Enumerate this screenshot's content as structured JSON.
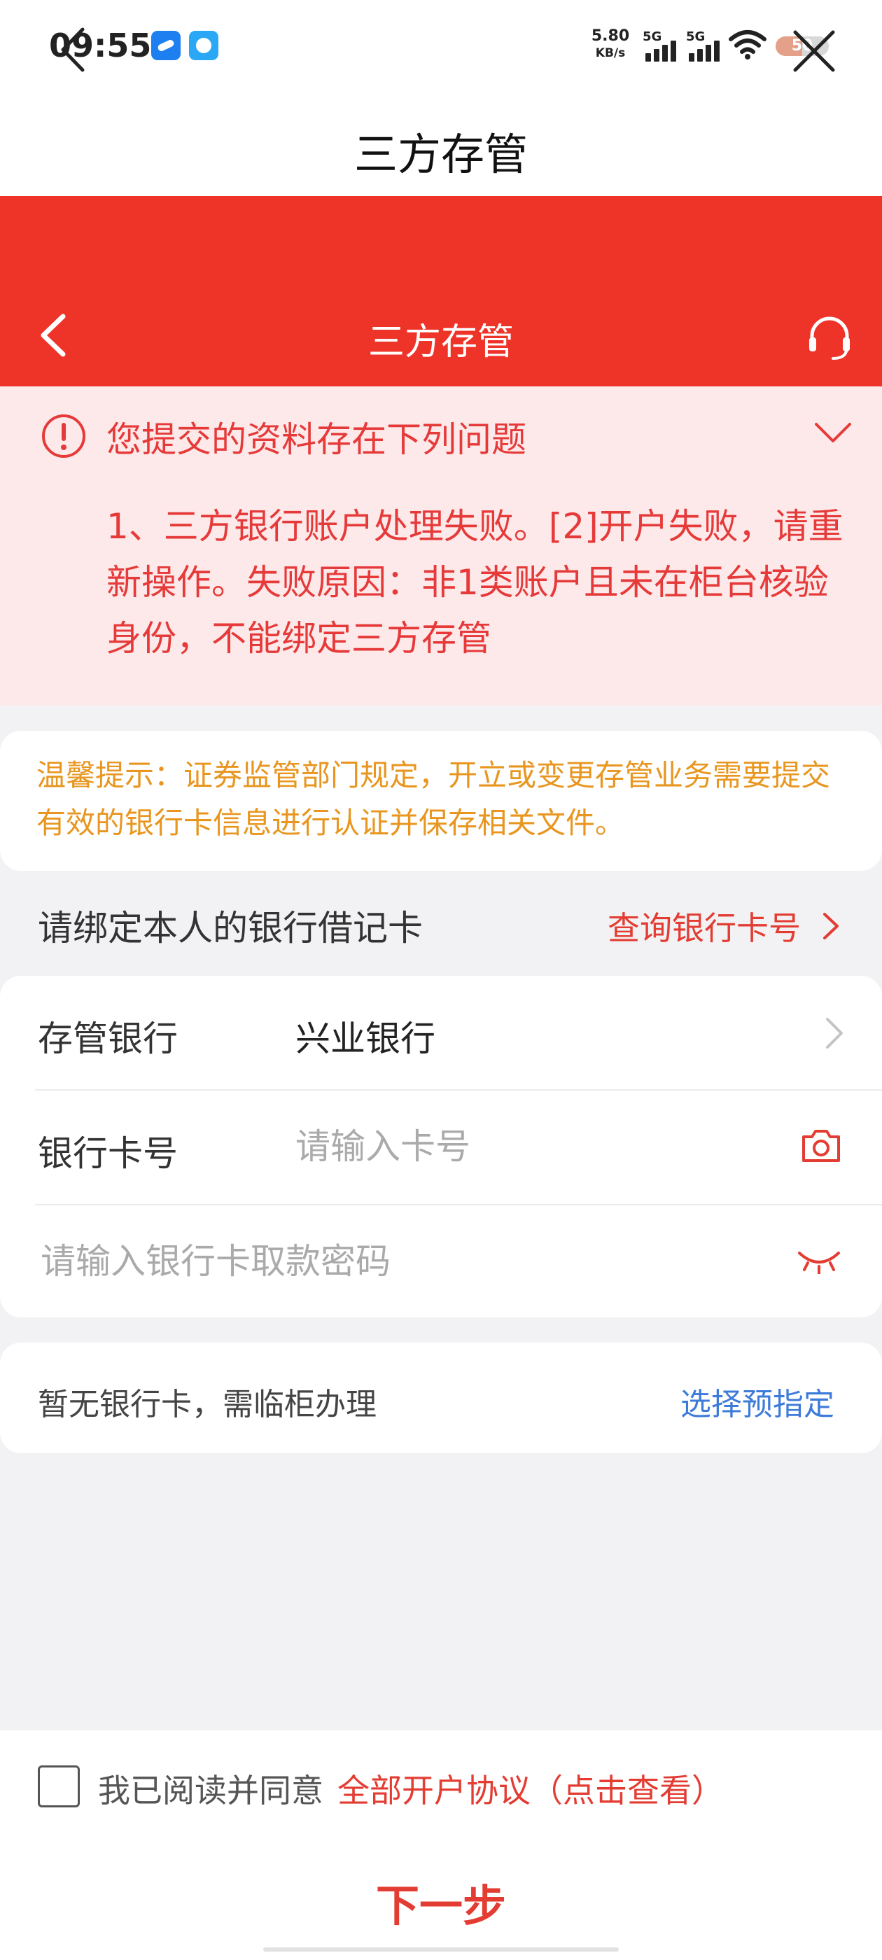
{
  "status_bar": {
    "time": "09:55",
    "net_speed": "5.80",
    "net_speed_unit": "KB/s",
    "signal_1_label": "5G",
    "signal_2_label": "5G",
    "battery_level": "50",
    "battery_percent": 50,
    "icons": [
      "app-icon-blue",
      "app-icon-bird",
      "wifi-icon",
      "battery-icon"
    ]
  },
  "navbar": {
    "title": "三方存管",
    "back_icon": "chevron-left-icon",
    "close_icon": "close-icon"
  },
  "app_header": {
    "title": "三方存管",
    "background_color": "#ee3329",
    "back_icon": "chevron-left-icon",
    "service_icon": "headset-icon"
  },
  "error_panel": {
    "title": "您提交的资料存在下列问题",
    "message": "1、三方银行账户处理失败。[2]开户失败，请重新操作。失败原因：非1类账户且未在柜台核验身份，不能绑定三方存管",
    "color": "#e63a3a"
  },
  "notice": {
    "text": "温馨提示：证券监管部门规定，开立或变更存管业务需要提交有效的银行卡信息进行认证并保存相关文件。",
    "color": "#e8961f"
  },
  "bind_section": {
    "label": "请绑定本人的银行借记卡",
    "query_link": "查询银行卡号"
  },
  "form": {
    "bank_label": "存管银行",
    "bank_value": "兴业银行",
    "card_label": "银行卡号",
    "card_value": "",
    "card_placeholder": "请输入卡号",
    "password_value": "",
    "password_placeholder": "请输入银行卡取款密码"
  },
  "no_card": {
    "text": "暂无银行卡，需临柜办理",
    "link": "选择预指定"
  },
  "agreement": {
    "checked": false,
    "text": "我已阅读并同意",
    "link": "全部开户协议（点击查看）"
  },
  "next_button": {
    "label": "下一步"
  }
}
